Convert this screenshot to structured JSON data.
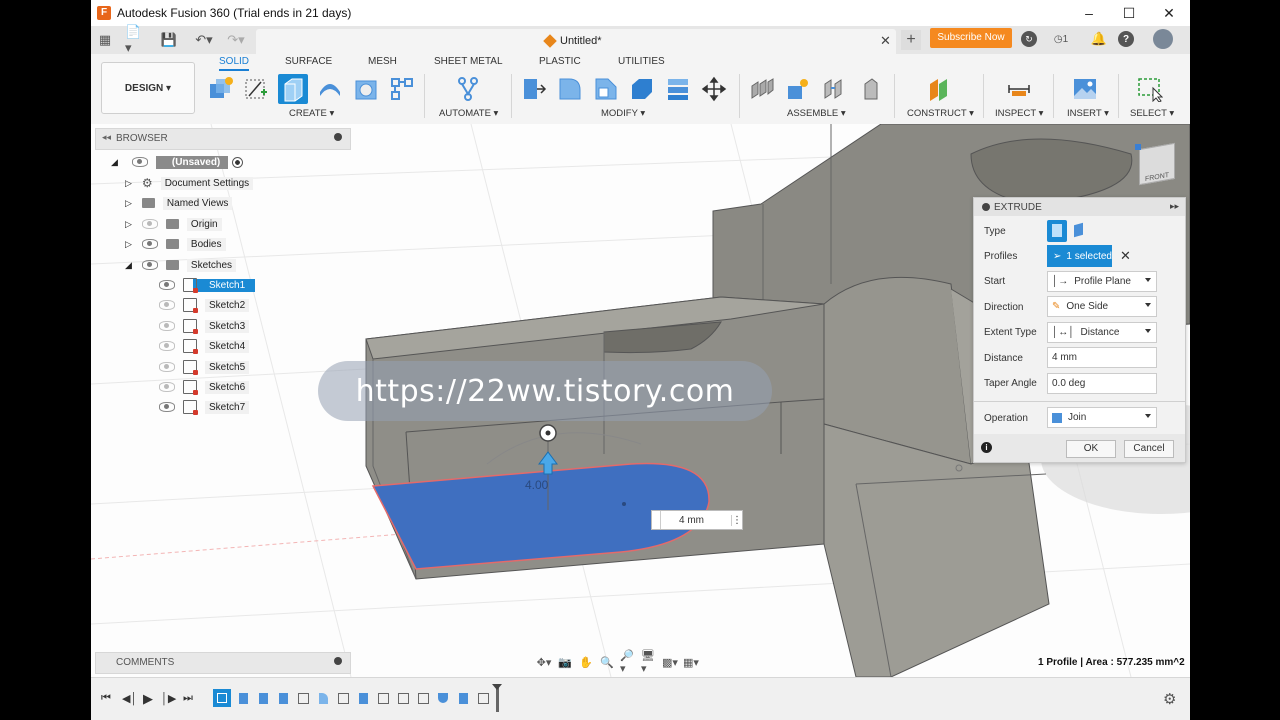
{
  "window": {
    "title": "Autodesk Fusion 360 (Trial ends in 21 days)",
    "logo_letter": "F"
  },
  "tabbar": {
    "doc_title": "Untitled*",
    "subscribe_label": "Subscribe Now",
    "job_count": "1"
  },
  "ribbon": {
    "workspace": "DESIGN",
    "tabs": [
      "SOLID",
      "SURFACE",
      "MESH",
      "SHEET METAL",
      "PLASTIC",
      "UTILITIES"
    ],
    "groups": [
      "CREATE",
      "AUTOMATE",
      "MODIFY",
      "ASSEMBLE",
      "CONSTRUCT",
      "INSPECT",
      "INSERT",
      "SELECT"
    ]
  },
  "browser": {
    "header": "BROWSER",
    "root": "(Unsaved)",
    "items": [
      "Document Settings",
      "Named Views",
      "Origin",
      "Bodies",
      "Sketches"
    ],
    "sketches": [
      "Sketch1",
      "Sketch2",
      "Sketch3",
      "Sketch4",
      "Sketch5",
      "Sketch6",
      "Sketch7"
    ]
  },
  "comments": {
    "header": "COMMENTS"
  },
  "extrude": {
    "header": "EXTRUDE",
    "labels": {
      "type": "Type",
      "profiles": "Profiles",
      "start": "Start",
      "direction": "Direction",
      "extent_type": "Extent Type",
      "distance": "Distance",
      "taper_angle": "Taper Angle",
      "operation": "Operation"
    },
    "values": {
      "profiles": "1 selected",
      "start": "Profile Plane",
      "direction": "One Side",
      "extent_type": "Distance",
      "distance": "4 mm",
      "taper_angle": "0.0 deg",
      "operation": "Join"
    },
    "ok_label": "OK",
    "cancel_label": "Cancel"
  },
  "viewport": {
    "dimension_label": "4.00",
    "dimension_input": "4 mm",
    "watermark": "https://22ww.tistory.com",
    "status": "1 Profile | Area : 577.235 mm^2",
    "viewcube_face": "FRONT"
  },
  "colors": {
    "accent": "#1a8ad4",
    "subscribe": "#f5891f",
    "profile_blue": "#3f6fc0",
    "body_gray": "#8a8983"
  }
}
